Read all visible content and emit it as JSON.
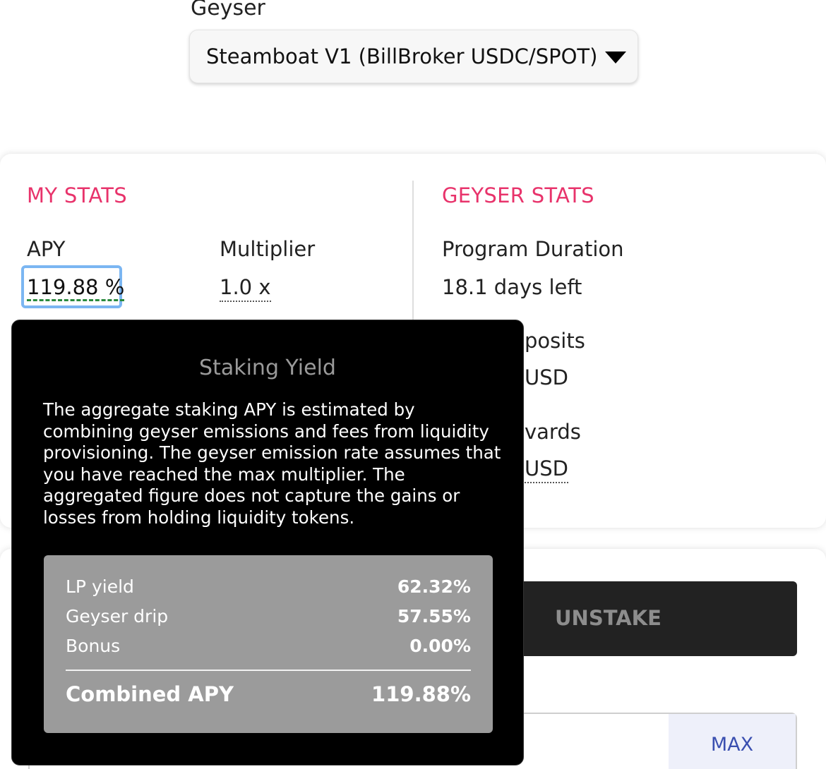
{
  "geyser": {
    "label": "Geyser",
    "selected": "Steamboat V1 (BillBroker USDC/SPOT)"
  },
  "my_stats": {
    "title": "MY STATS",
    "apy_label": "APY",
    "apy_value": "119.88 %",
    "multiplier_label": "Multiplier",
    "multiplier_value": "1.0 x"
  },
  "geyser_stats": {
    "title": "GEYSER STATS",
    "duration_label": "Program Duration",
    "duration_value": "18.1 days left",
    "deposits_label_partial": "posits",
    "deposits_value_partial": "USD",
    "rewards_label_partial": "vards",
    "rewards_value_partial": "USD"
  },
  "actions": {
    "unstake_label": "UNSTAKE",
    "max_label": "MAX"
  },
  "tooltip": {
    "title": "Staking Yield",
    "body": "The aggregate staking APY is estimated by combining geyser emissions and fees from liquidity provisioning. The geyser emission rate assumes that you have reached the max multiplier. The aggregated figure does not capture the gains or losses from holding liquidity tokens.",
    "rows": [
      {
        "label": "LP yield",
        "value": "62.32%"
      },
      {
        "label": "Geyser drip",
        "value": "57.55%"
      },
      {
        "label": "Bonus",
        "value": "0.00%"
      }
    ],
    "total_label": "Combined APY",
    "total_value": "119.88%"
  },
  "colors": {
    "accent": "#e8336b",
    "focus_ring": "#7bb6f2",
    "apy_underline": "#2a8a3e"
  }
}
